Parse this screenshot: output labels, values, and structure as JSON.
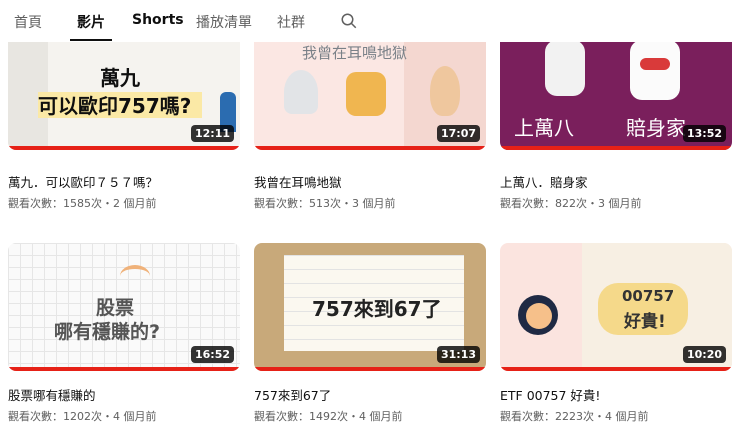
{
  "tabs": [
    {
      "label": "首頁"
    },
    {
      "label": "影片"
    },
    {
      "label": "Shorts"
    },
    {
      "label": "播放清單"
    },
    {
      "label": "社群"
    }
  ],
  "videos": [
    {
      "title": "萬九．可以歐印７５７嗎？",
      "meta": "觀看次數：1585次・2 個月前",
      "duration": "12:11",
      "thumb_text": [
        "萬九",
        "可以歐印757嗎?"
      ]
    },
    {
      "title": "我曾在耳鳴地獄",
      "meta": "觀看次數：513次・3 個月前",
      "duration": "17:07",
      "thumb_text": [
        "我曾在耳鳴地獄"
      ]
    },
    {
      "title": "上萬八．賠身家",
      "meta": "觀看次數：822次・3 個月前",
      "duration": "13:52",
      "thumb_text": [
        "上萬八",
        "賠身家"
      ]
    },
    {
      "title": "股票哪有穩賺的",
      "meta": "觀看次數：1202次・4 個月前",
      "duration": "16:52",
      "thumb_text": [
        "股票",
        "哪有穩賺的?"
      ]
    },
    {
      "title": "757來到67了",
      "meta": "觀看次數：1492次・4 個月前",
      "duration": "31:13",
      "thumb_text": [
        "757來到67了"
      ]
    },
    {
      "title": "ETF 00757 好貴!",
      "meta": "觀看次數：2223次・4 個月前",
      "duration": "10:20",
      "thumb_text": [
        "00757",
        "好貴!"
      ]
    }
  ],
  "colors": {
    "progress": "#e62117",
    "accent_purple": "#7a1f5c"
  }
}
